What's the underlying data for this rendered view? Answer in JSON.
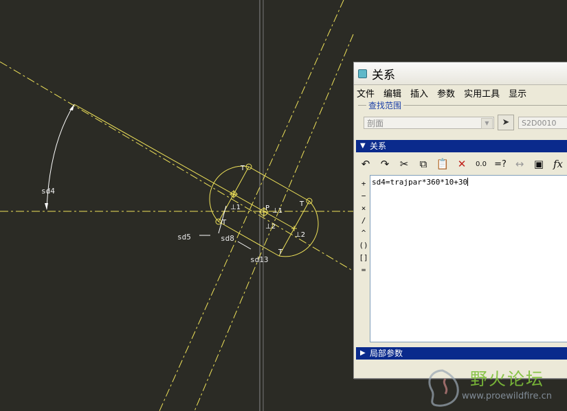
{
  "sketch": {
    "dims": {
      "sd4": "sd4",
      "sd5": "sd5",
      "sd8": "sd8",
      "sd13": "sd13"
    },
    "tags": {
      "t_top": "T",
      "t_right": "T",
      "t_left": "T",
      "t_low": "T",
      "perp1": "⊥1",
      "perp1b": "⊥1",
      "perp2": "⊥2",
      "perp2b": "⊥2",
      "p": "P"
    }
  },
  "dialog": {
    "title": "关系",
    "menu": [
      "文件",
      "编辑",
      "插入",
      "参数",
      "实用工具",
      "显示"
    ],
    "search_scope_label": "查找范围",
    "scope_value": "剖面",
    "selection_value": "S2D0010",
    "relations_section": "关系",
    "local_params_section": "局部参数",
    "operators": [
      "+",
      "−",
      "×",
      "/",
      "^",
      "()",
      "[]",
      "="
    ],
    "relation_text": "sd4=trajpar*360*10+30",
    "toolbar_icons": [
      "undo-icon",
      "redo-icon",
      "cut-icon",
      "copy-icon",
      "paste-icon",
      "delete-icon",
      "units-icon",
      "evaluate-icon",
      "dimension-icon",
      "sort-icon",
      "function-icon"
    ]
  },
  "watermark": {
    "title": "野火论坛",
    "url": "www.proewildfire.cn"
  },
  "colors": {
    "background": "#2b2b25",
    "sketch": "#f0e35a",
    "section_bar": "#0a2a8c"
  }
}
